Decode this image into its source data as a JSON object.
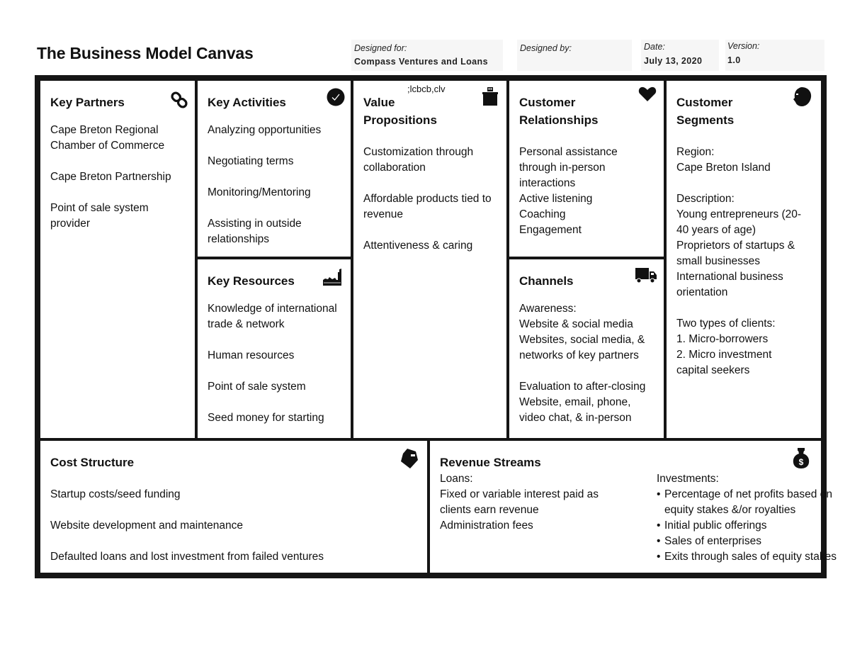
{
  "header": {
    "title": "The Business Model Canvas",
    "designed_for_label": "Designed for:",
    "designed_for_value": "Compass Ventures and Loans",
    "designed_by_label": "Designed by:",
    "designed_by_value": "",
    "date_label": "Date:",
    "date_value": "July 13, 2020",
    "version_label": "Version:",
    "version_value": "1.0"
  },
  "key_partners": {
    "title": "Key Partners",
    "icon": "link-icon",
    "items": [
      "Cape Breton Regional Chamber of Commerce",
      "Cape Breton Partnership",
      "Point of sale system provider"
    ]
  },
  "key_activities": {
    "title": "Key Activities",
    "icon": "check-circle-icon",
    "items": [
      "Analyzing opportunities",
      "Negotiating terms",
      "Monitoring/Mentoring",
      "Assisting in outside relationships"
    ]
  },
  "key_resources": {
    "title": "Key Resources",
    "icon": "factory-icon",
    "items": [
      "Knowledge of international trade & network",
      "Human resources",
      "Point of sale system",
      "Seed money for starting"
    ]
  },
  "value_propositions": {
    "title_line1": "Value",
    "title_line2": "Propositions",
    "annotation": ";lcbcb,clv",
    "icon": "gift-icon",
    "items": [
      "Customization through collaboration",
      "Affordable products tied to revenue",
      "Attentiveness & caring"
    ]
  },
  "customer_relationships": {
    "title_line1": "Customer",
    "title_line2": "Relationships",
    "icon": "heart-icon",
    "lines": [
      "Personal assistance through in-person interactions",
      "Active listening",
      "Coaching",
      "Engagement"
    ]
  },
  "channels": {
    "title": "Channels",
    "icon": "truck-icon",
    "groups": [
      {
        "lines": [
          "Awareness:",
          "Website & social media",
          "Websites, social media, & networks of key partners"
        ]
      },
      {
        "lines": [
          "Evaluation to after-closing",
          "Website, email, phone, video chat, & in-person"
        ]
      }
    ]
  },
  "customer_segments": {
    "title_line1": "Customer",
    "title_line2": "Segments",
    "icon": "person-head-icon",
    "groups": [
      {
        "lines": [
          "Region:",
          "Cape Breton Island"
        ]
      },
      {
        "lines": [
          "Description:",
          "Young entrepreneurs (20-40 years of age)",
          "Proprietors of startups & small businesses",
          "International business orientation"
        ]
      },
      {
        "lines": [
          "Two types of clients:",
          "1. Micro-borrowers",
          "2. Micro investment capital seekers"
        ]
      }
    ]
  },
  "cost_structure": {
    "title": "Cost Structure",
    "icon": "price-tag-icon",
    "items": [
      "Startup costs/seed funding",
      "Website development and maintenance",
      "Defaulted loans and lost investment from failed ventures"
    ]
  },
  "revenue_streams": {
    "title": "Revenue Streams",
    "icon": "money-bag-icon",
    "loans_label": "Loans:",
    "loans_lines": [
      "Fixed or variable interest paid as clients earn revenue",
      "Administration fees"
    ],
    "investments_label": "Investments:",
    "investments_items": [
      "Percentage of net profits based on equity stakes &/or royalties",
      "Initial public offerings",
      "Sales of enterprises",
      "Exits through sales of equity stakes"
    ]
  }
}
